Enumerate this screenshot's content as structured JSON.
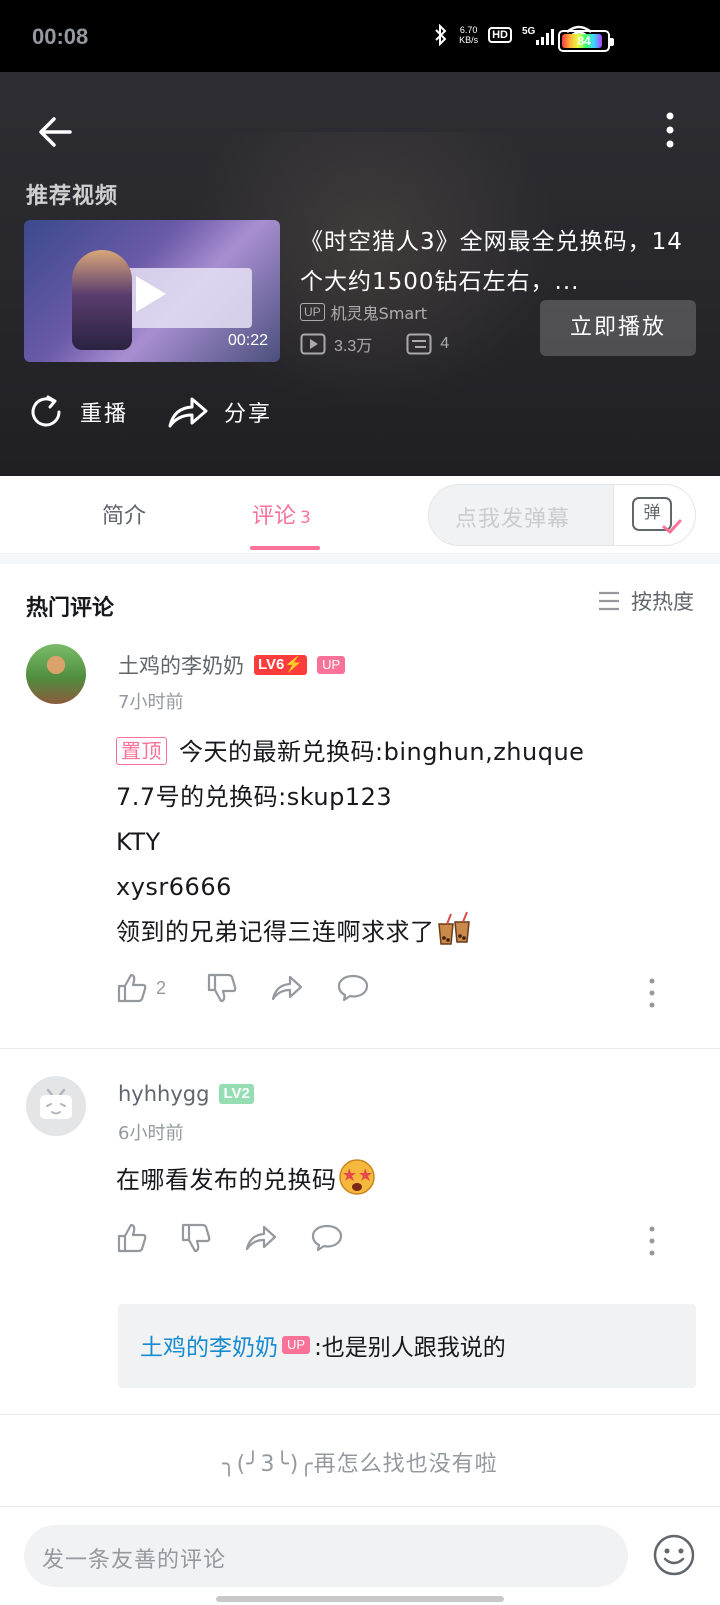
{
  "status_bar": {
    "time": "00:08",
    "net_speed": "6.70",
    "net_unit": "KB/s",
    "hd": "HD",
    "signal": "5G",
    "battery": "84"
  },
  "player": {
    "recommend_label": "推荐视频",
    "rec_title": "《时空猎人3》全网最全兑换码，14个大约1500钻石左右，...",
    "duration": "00:22",
    "up_tag": "UP",
    "uploader": "机灵鬼Smart",
    "views": "3.3万",
    "danmaku_count": "4",
    "play_now": "立即播放",
    "replay": "重播",
    "share": "分享"
  },
  "tabs": {
    "intro": "简介",
    "comments": "评论",
    "comments_count": "3",
    "danmaku_placeholder": "点我发弹幕",
    "danmaku_icon": "弹"
  },
  "comments_header": {
    "title": "热门评论",
    "sort": "按热度"
  },
  "comments": [
    {
      "user": "土鸡的李奶奶",
      "level": "LV6⚡",
      "up_badge": "UP",
      "time": "7小时前",
      "pin": "置顶",
      "lines": [
        "今天的最新兑换码:binghun,zhuque",
        "7.7号的兑换码:skup123",
        "KTY",
        "xysr6666",
        "领到的兄弟记得三连啊求求了"
      ],
      "likes": "2"
    },
    {
      "user": "hyhhygg",
      "level": "LV2",
      "time": "6小时前",
      "text": "在哪看发布的兑换码",
      "reply": {
        "user": "土鸡的李奶奶",
        "up_badge": "UP",
        "text": ":也是别人跟我说的"
      }
    }
  ],
  "end_text": "╮(╯3╰)╭再怎么找也没有啦",
  "bottom": {
    "input_placeholder": "发一条友善的评论"
  },
  "colors": {
    "accent": "#fb7299",
    "reply_name": "#178bcf",
    "lv6": "#ff3c3c",
    "lv2": "#95ddb2"
  }
}
